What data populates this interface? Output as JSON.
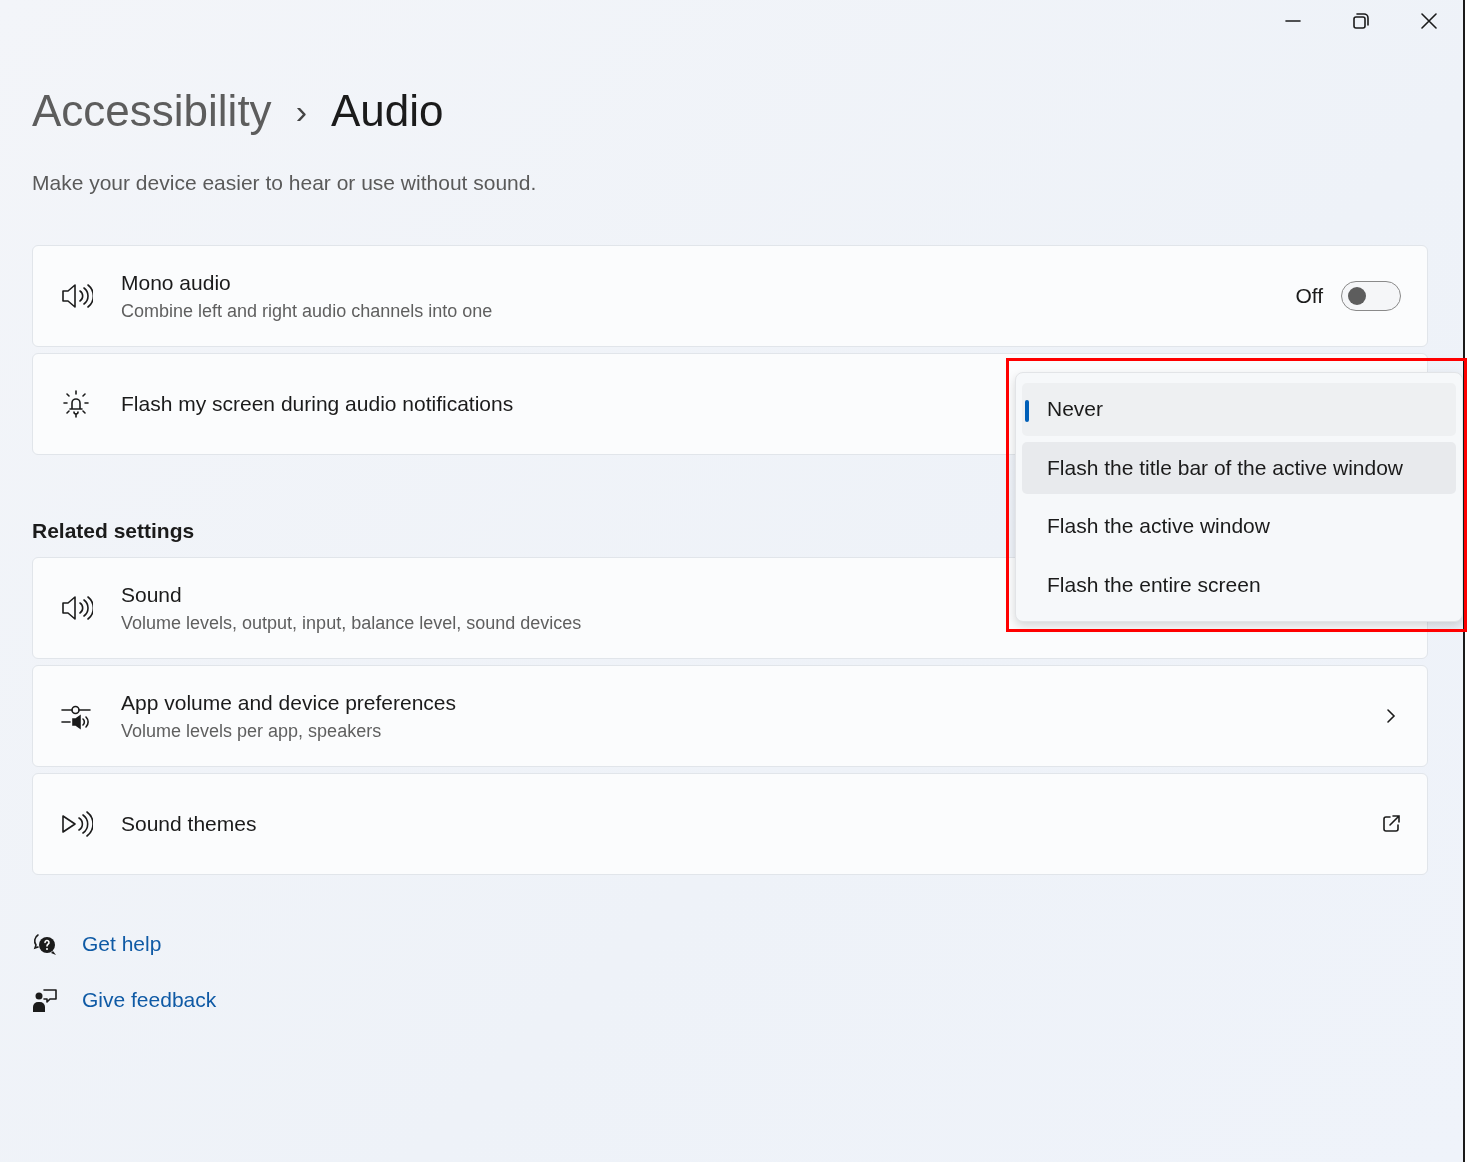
{
  "breadcrumb": {
    "parent": "Accessibility",
    "separator": "›",
    "current": "Audio"
  },
  "description": "Make your device easier to hear or use without sound.",
  "settings": [
    {
      "kind": "toggle",
      "title": "Mono audio",
      "subtitle": "Combine left and right audio channels into one",
      "state_label": "Off",
      "on": false
    },
    {
      "kind": "dropdown",
      "title": "Flash my screen during audio notifications"
    }
  ],
  "related": {
    "heading": "Related settings",
    "items": [
      {
        "kind": "covered",
        "title": "Sound",
        "subtitle": "Volume levels, output, input, balance level, sound devices"
      },
      {
        "kind": "chevron",
        "title": "App volume and device preferences",
        "subtitle": "Volume levels per app, speakers"
      },
      {
        "kind": "external",
        "title": "Sound themes"
      }
    ]
  },
  "links": [
    {
      "label": "Get help"
    },
    {
      "label": "Give feedback"
    }
  ],
  "dropdown_menu": {
    "highlighted": true,
    "options": [
      {
        "label": "Never",
        "selected": true,
        "hovered": false
      },
      {
        "label": "Flash the title bar of the active window",
        "selected": false,
        "hovered": true
      },
      {
        "label": "Flash the active window",
        "selected": false,
        "hovered": false
      },
      {
        "label": "Flash the entire screen",
        "selected": false,
        "hovered": false
      }
    ]
  }
}
